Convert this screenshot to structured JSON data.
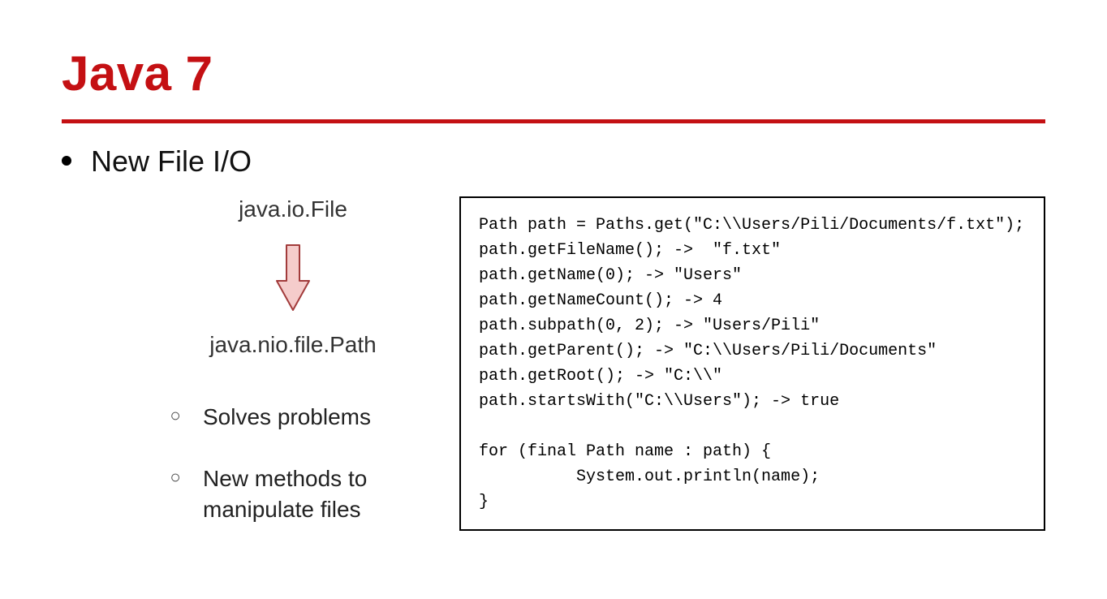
{
  "title": "Java 7",
  "bullet": "New File I/O",
  "left": {
    "old_api": "java.io.File",
    "new_api": "java.nio.file.Path",
    "sub_items": [
      "Solves problems",
      "New methods to manipulate files"
    ]
  },
  "code": "Path path = Paths.get(\"C:\\\\Users/Pili/Documents/f.txt\");\npath.getFileName(); ->  \"f.txt\"\npath.getName(0); -> \"Users\"\npath.getNameCount(); -> 4\npath.subpath(0, 2); -> \"Users/Pili\"\npath.getParent(); -> \"C:\\\\Users/Pili/Documents\"\npath.getRoot(); -> \"C:\\\\\"\npath.startsWith(\"C:\\\\Users\"); -> true\n\nfor (final Path name : path) {\n          System.out.println(name);\n}",
  "colors": {
    "accent": "#c41013",
    "arrow_fill": "#f5cccb",
    "arrow_stroke": "#a23b3b"
  }
}
